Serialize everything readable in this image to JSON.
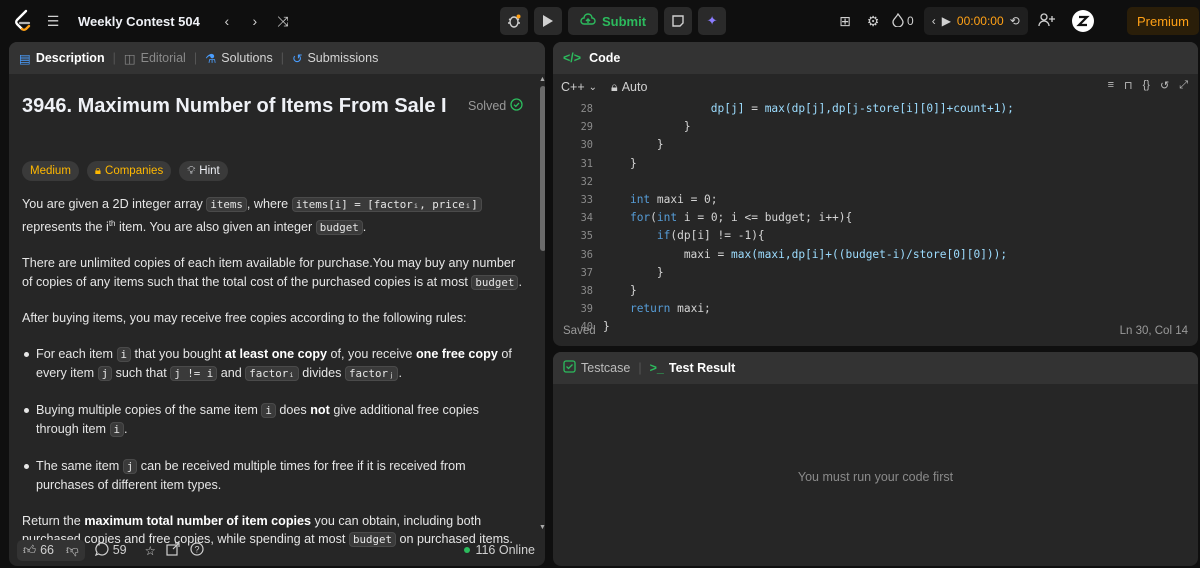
{
  "topbar": {
    "contest_title": "Weekly Contest 504",
    "submit_label": "Submit",
    "streak_count": "0",
    "timer": "00:00:00",
    "premium_label": "Premium"
  },
  "left": {
    "tabs": [
      {
        "label": "Description"
      },
      {
        "label": "Editorial"
      },
      {
        "label": "Solutions"
      },
      {
        "label": "Submissions"
      }
    ],
    "title": "3946. Maximum Number of Items From Sale I",
    "solved_label": "Solved",
    "chips": {
      "difficulty": "Medium",
      "companies": "Companies",
      "hint": "Hint"
    },
    "p1": {
      "a": "You are given a 2D integer array ",
      "c1": "items",
      "b": ", where ",
      "c2": "items[i] = [factorᵢ, priceᵢ]",
      "c": " represents the ",
      "i": "i",
      "th": "th",
      "d": " item. You are also given an integer ",
      "c3": "budget",
      "e": "."
    },
    "p2": {
      "a": "There are unlimited copies of each item available for purchase.You may buy any number of copies of any items such that the total cost of the purchased copies is at most ",
      "c1": "budget",
      "e": "."
    },
    "p3": "After buying items, you may receive free copies according to the following rules:",
    "b1": {
      "a": "For each item ",
      "c1": "i",
      "b": " that you bought ",
      "s1": "at least one copy",
      "c": " of, you receive ",
      "s2": "one free copy",
      "d": " of every item ",
      "c2": "j",
      "e": " such that ",
      "c3": "j != i",
      "f": " and ",
      "c4": "factorᵢ",
      "g": " divides ",
      "c5": "factorⱼ",
      "h": "."
    },
    "b2": {
      "a": "Buying multiple copies of the same item ",
      "c1": "i",
      "b": " does ",
      "s1": "not",
      "c": " give additional free copies through item ",
      "c2": "i",
      "d": "."
    },
    "b3": {
      "a": "The same item ",
      "c1": "j",
      "b": " can be received multiple times for free if it is received from purchases of different item types."
    },
    "p4": {
      "a": "Return the ",
      "s1": "maximum total number of item copies",
      "b": " you can obtain, including both purchased copies and free copies, while spending at most ",
      "c1": "budget",
      "c": " on purchased items."
    },
    "footer": {
      "likes": "66",
      "comments": "59",
      "online": "116 Online"
    }
  },
  "code": {
    "title": "Code",
    "language": "C++",
    "mode": "Auto",
    "line_numbers": [
      "28",
      "29",
      "30",
      "31",
      "32",
      "33",
      "34",
      "35",
      "36",
      "37",
      "38",
      "39",
      "40"
    ],
    "saved_label": "Saved",
    "cursor_pos": "Ln 30, Col 14"
  },
  "test": {
    "tab_testcase": "Testcase",
    "tab_result": "Test Result",
    "empty_message": "You must run your code first"
  },
  "colors": {
    "accent": "#ffa116",
    "green": "#2cbb5d",
    "easy_medium": "#ffb800"
  }
}
